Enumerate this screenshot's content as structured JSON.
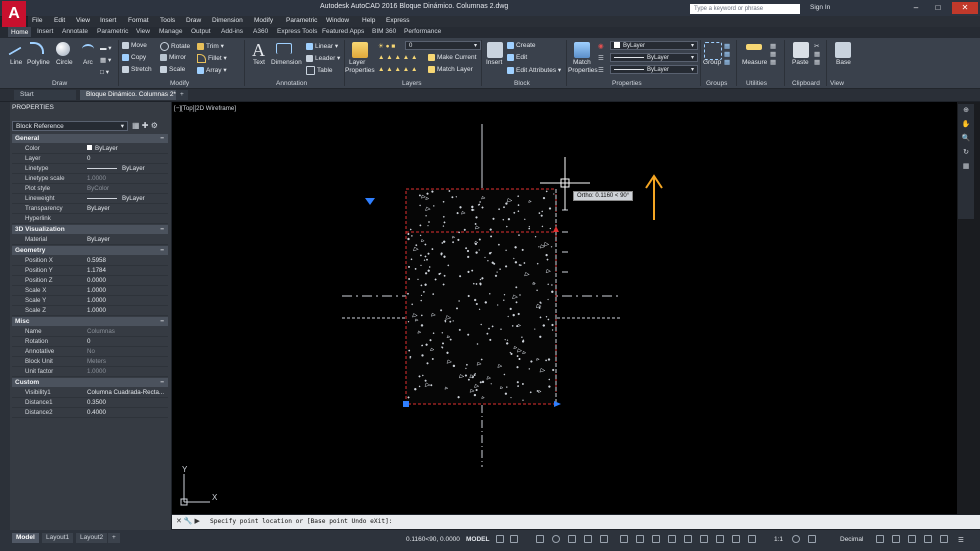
{
  "app": {
    "logo_letter": "A",
    "title": "Autodesk AutoCAD 2016     Bloque Dinámico. Columnas 2.dwg",
    "search_placeholder": "Type a keyword or phrase",
    "signin": "Sign In"
  },
  "menubar": [
    "File",
    "Edit",
    "View",
    "Insert",
    "Format",
    "Tools",
    "Draw",
    "Dimension",
    "Modify",
    "Parametric",
    "Window",
    "Help",
    "Express"
  ],
  "ribbon_tabs": [
    "Home",
    "Insert",
    "Annotate",
    "Parametric",
    "View",
    "Manage",
    "Output",
    "Add-ins",
    "A360",
    "Express Tools",
    "Featured Apps",
    "BIM 360",
    "Performance"
  ],
  "ribbon": {
    "draw": {
      "title": "Draw",
      "line": "Line",
      "polyline": "Polyline",
      "circle": "Circle",
      "arc": "Arc"
    },
    "modify": {
      "title": "Modify",
      "move": "Move",
      "rotate": "Rotate",
      "trim": "Trim",
      "copy": "Copy",
      "mirror": "Mirror",
      "fillet": "Fillet",
      "stretch": "Stretch",
      "scale": "Scale",
      "array": "Array"
    },
    "annotation": {
      "title": "Annotation",
      "text": "Text",
      "dimension": "Dimension",
      "linear": "Linear",
      "leader": "Leader",
      "table": "Table"
    },
    "layers": {
      "title": "Layers",
      "layer_properties": "Layer Properties",
      "layer_value": "0",
      "make_current": "Make Current",
      "match_layer": "Match Layer"
    },
    "block": {
      "title": "Block",
      "insert": "Insert",
      "create": "Create",
      "edit": "Edit",
      "edit_attributes": "Edit Attributes"
    },
    "properties": {
      "title": "Properties",
      "match_properties": "Match Properties",
      "color": "ByLayer",
      "linetype": "ByLayer",
      "lineweight": "ByLayer"
    },
    "groups": {
      "title": "Groups",
      "group": "Group"
    },
    "utilities": {
      "title": "Utilities",
      "measure": "Measure"
    },
    "clipboard": {
      "title": "Clipboard",
      "paste": "Paste"
    },
    "view": {
      "title": "View",
      "base": "Base"
    }
  },
  "doc_tabs": {
    "start": "Start",
    "active": "Bloque Dinámico. Columnas 2*"
  },
  "properties_palette": {
    "title": "PROPERTIES",
    "selection": "Block Reference",
    "sections": [
      {
        "name": "General",
        "rows": [
          {
            "label": "Color",
            "value": "ByLayer"
          },
          {
            "label": "Layer",
            "value": "0"
          },
          {
            "label": "Linetype",
            "value": "ByLayer"
          },
          {
            "label": "Linetype scale",
            "value": "1.0000"
          },
          {
            "label": "Plot style",
            "value": "ByColor"
          },
          {
            "label": "Lineweight",
            "value": "ByLayer"
          },
          {
            "label": "Transparency",
            "value": "ByLayer"
          },
          {
            "label": "Hyperlink",
            "value": ""
          }
        ]
      },
      {
        "name": "3D Visualization",
        "rows": [
          {
            "label": "Material",
            "value": "ByLayer"
          }
        ]
      },
      {
        "name": "Geometry",
        "rows": [
          {
            "label": "Position X",
            "value": "0.5958"
          },
          {
            "label": "Position Y",
            "value": "1.1784"
          },
          {
            "label": "Position Z",
            "value": "0.0000"
          },
          {
            "label": "Scale X",
            "value": "1.0000"
          },
          {
            "label": "Scale Y",
            "value": "1.0000"
          },
          {
            "label": "Scale Z",
            "value": "1.0000"
          }
        ]
      },
      {
        "name": "Misc",
        "rows": [
          {
            "label": "Name",
            "value": "Columnas"
          },
          {
            "label": "Rotation",
            "value": "0"
          },
          {
            "label": "Annotative",
            "value": "No"
          },
          {
            "label": "Block Unit",
            "value": "Meters"
          },
          {
            "label": "Unit factor",
            "value": "1.0000"
          }
        ]
      },
      {
        "name": "Custom",
        "rows": [
          {
            "label": "Visibility1",
            "value": "Columna  Cuadrada-Recta..."
          },
          {
            "label": "Distance1",
            "value": "0.3500"
          },
          {
            "label": "Distance2",
            "value": "0.4000"
          }
        ]
      }
    ]
  },
  "viewport": {
    "label": "[−][Top][2D Wireframe]",
    "tooltip": "Ortho: 0.1160 < 90°",
    "ucs_y": "Y",
    "ucs_x": "X"
  },
  "command_line": "Specify point location or [Base point Undo eXit]:",
  "layout_tabs": [
    "Model",
    "Layout1",
    "Layout2"
  ],
  "status": {
    "coords": "0.1160<90, 0.0000",
    "model": "MODEL",
    "scale": "1:1",
    "units": "Decimal"
  },
  "colors": {
    "accent_orange": "#f5a623",
    "selection_red": "#e03030",
    "grip_blue": "#2f7fff"
  }
}
